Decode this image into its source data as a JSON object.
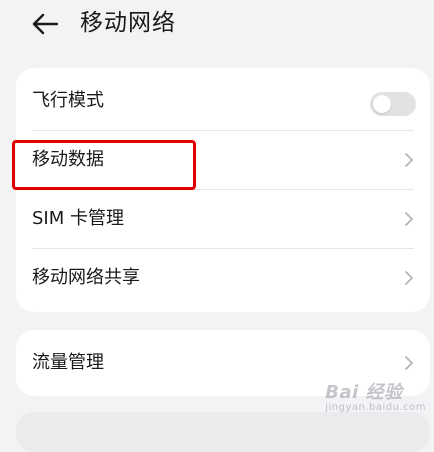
{
  "header": {
    "title": "移动网络"
  },
  "card1": {
    "airplane": {
      "label": "飞行模式",
      "toggle_on": false
    },
    "mobile_data": {
      "label": "移动数据"
    },
    "sim": {
      "label": "SIM 卡管理"
    },
    "hotspot": {
      "label": "移动网络共享"
    }
  },
  "card2": {
    "traffic": {
      "label": "流量管理"
    }
  },
  "watermark": {
    "main": "Bai 经验",
    "sub": "jingyan.baidu.com"
  },
  "colors": {
    "background": "#f1f3f5",
    "card": "#ffffff",
    "highlight": "#e00000",
    "toggle_off": "#e2e2e2"
  }
}
